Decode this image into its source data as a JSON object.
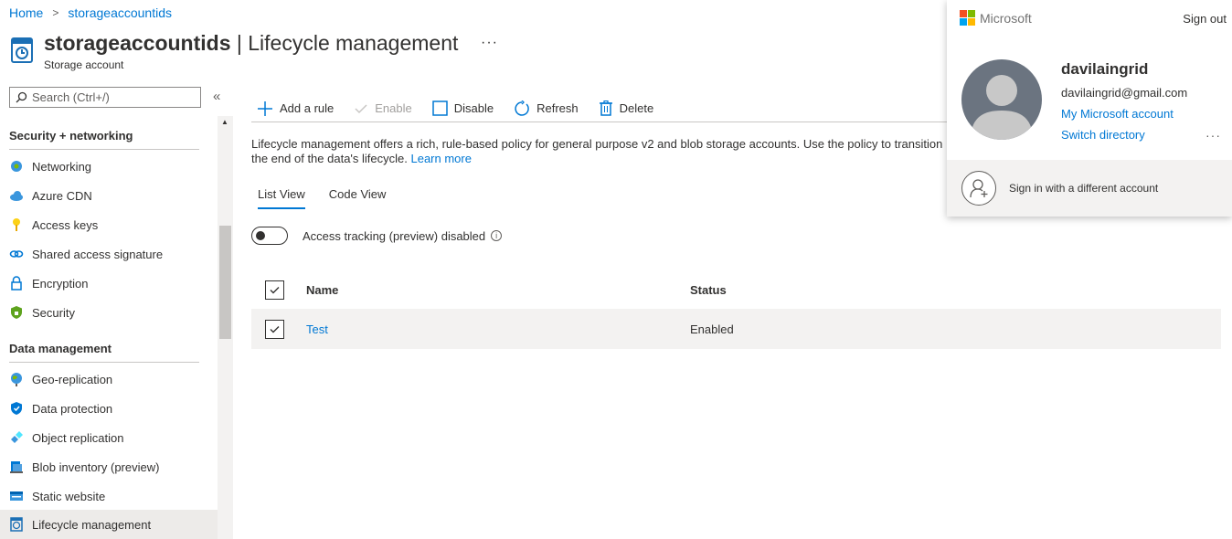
{
  "breadcrumb": {
    "home": "Home",
    "resource": "storageaccountids"
  },
  "header": {
    "resource_name": "storageaccountids",
    "page_name": " | Lifecycle management",
    "subtitle": "Storage account",
    "more": "···"
  },
  "sidebar": {
    "search_placeholder": "Search (Ctrl+/)",
    "collapse": "«",
    "sections": [
      {
        "title": "Security + networking"
      },
      {
        "title": "Data management"
      }
    ],
    "items": [
      {
        "label": "Networking",
        "icon": "networking-icon"
      },
      {
        "label": "Azure CDN",
        "icon": "cdn-cloud-icon"
      },
      {
        "label": "Access keys",
        "icon": "key-icon"
      },
      {
        "label": "Shared access signature",
        "icon": "link-icon"
      },
      {
        "label": "Encryption",
        "icon": "lock-icon"
      },
      {
        "label": "Security",
        "icon": "shield-icon"
      },
      {
        "label": "Geo-replication",
        "icon": "globe-icon"
      },
      {
        "label": "Data protection",
        "icon": "shield-blue-icon"
      },
      {
        "label": "Object replication",
        "icon": "replication-icon"
      },
      {
        "label": "Blob inventory (preview)",
        "icon": "inventory-icon"
      },
      {
        "label": "Static website",
        "icon": "website-icon"
      },
      {
        "label": "Lifecycle management",
        "icon": "lifecycle-icon"
      }
    ]
  },
  "toolbar": {
    "add_rule": "Add a rule",
    "enable": "Enable",
    "disable": "Disable",
    "refresh": "Refresh",
    "delete": "Delete"
  },
  "description": {
    "line1": "Lifecycle management offers a rich, rule-based policy for general purpose v2 and blob storage accounts. Use the policy to transition y",
    "line2": "the end of the data's lifecycle. ",
    "learn_more": "Learn more"
  },
  "tabs": {
    "list": "List View",
    "code": "Code View"
  },
  "access_tracking": {
    "label": "Access tracking (preview) disabled",
    "info": "i"
  },
  "grid": {
    "headers": {
      "name": "Name",
      "status": "Status"
    },
    "rows": [
      {
        "name": "Test",
        "status": "Enabled"
      }
    ]
  },
  "account": {
    "brand": "Microsoft",
    "sign_out": "Sign out",
    "name": "davilaingrid",
    "email": "davilaingrid@gmail.com",
    "my_account": "My Microsoft account",
    "switch_directory": "Switch directory",
    "more": "···",
    "sign_in_different": "Sign in with a different account"
  },
  "colors": {
    "accent": "#0078d4",
    "text": "#323130",
    "selected_row": "#f3f2f1"
  }
}
